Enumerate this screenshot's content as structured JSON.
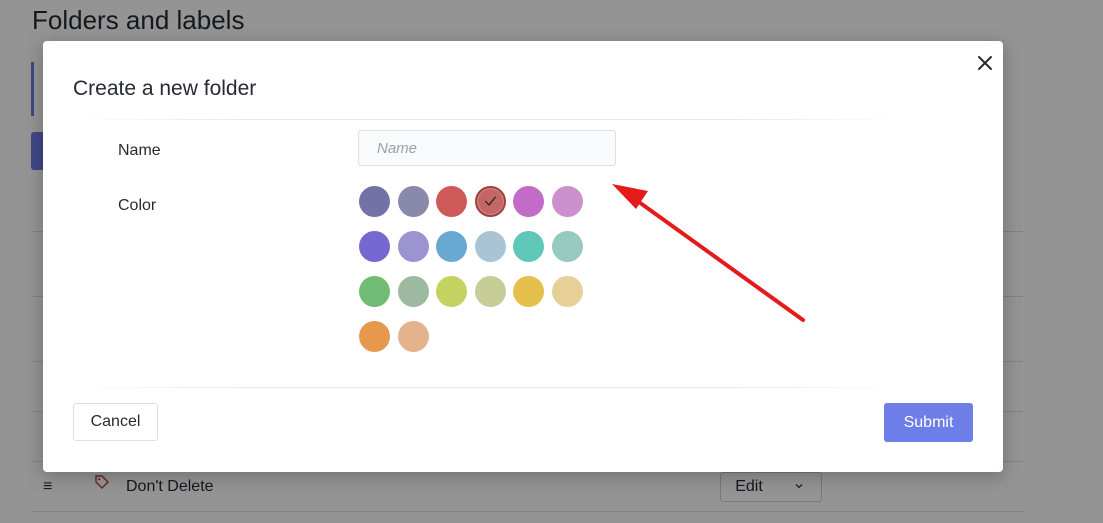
{
  "background": {
    "page_title": "Folders and labels",
    "row": {
      "label": "Don't Delete",
      "edit_label": "Edit",
      "tag_color": "#b34141"
    }
  },
  "modal": {
    "title": "Create a new folder",
    "name_label": "Name",
    "name_placeholder": "Name",
    "name_value": "",
    "color_label": "Color",
    "selected_color": "#c26666",
    "colors": [
      "#7272a7",
      "#8989ac",
      "#cf5858",
      "#c26666",
      "#c26cc7",
      "#cc90cc",
      "#7569d1",
      "#9b94d1",
      "#69a9d1",
      "#a8c4d5",
      "#5ec7b7",
      "#97c9c1",
      "#72bb75",
      "#9db99f",
      "#c3d261",
      "#c6cd97",
      "#e6c04c",
      "#e6d097",
      "#e6984c",
      "#e2b38d"
    ],
    "cancel_label": "Cancel",
    "submit_label": "Submit"
  },
  "icons": {
    "close": "close-icon",
    "check": "check-icon",
    "drag": "drag-handle-icon",
    "tag": "tag-icon",
    "caret": "chevron-down-icon"
  },
  "annotation": {
    "arrow_color": "#e31b1b"
  }
}
